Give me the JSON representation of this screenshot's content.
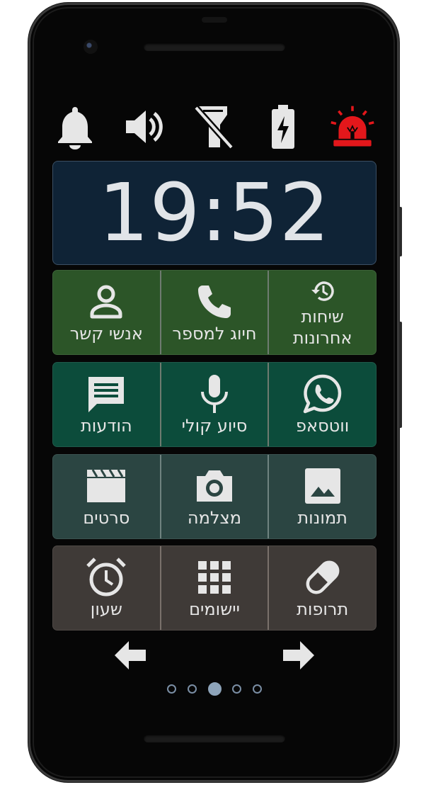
{
  "clock": {
    "time": "19:52"
  },
  "status_icons": [
    "bell-icon",
    "volume-icon",
    "flashlight-off-icon",
    "battery-charging-icon",
    "emergency-siren-icon"
  ],
  "colors": {
    "clock_bg": "#0f2336",
    "row1": "#2c5528",
    "row2": "#0c4c3b",
    "row3": "#2b4542",
    "row4": "#3f3a37",
    "siren": "#e3171b",
    "icon": "#e6e6e6"
  },
  "rows": [
    {
      "tiles": [
        {
          "label": "אנשי קשר",
          "icon": "person-icon"
        },
        {
          "label": "חיוג למספר",
          "icon": "phone-icon"
        },
        {
          "label_line1": "שיחות",
          "label_line2": "אחרונות",
          "icon": "history-icon"
        }
      ]
    },
    {
      "tiles": [
        {
          "label": "הודעות",
          "icon": "message-icon"
        },
        {
          "label": "סיוע קולי",
          "icon": "microphone-icon"
        },
        {
          "label": "ווטסאפ",
          "icon": "whatsapp-icon"
        }
      ]
    },
    {
      "tiles": [
        {
          "label": "סרטים",
          "icon": "clapperboard-icon"
        },
        {
          "label": "מצלמה",
          "icon": "camera-icon"
        },
        {
          "label": "תמונות",
          "icon": "image-icon"
        }
      ]
    },
    {
      "tiles": [
        {
          "label": "שעון",
          "icon": "alarm-clock-icon"
        },
        {
          "label": "יישומים",
          "icon": "apps-grid-icon"
        },
        {
          "label": "תרופות",
          "icon": "pill-icon"
        }
      ]
    }
  ],
  "navigation": {
    "prev": "arrow-left-icon",
    "next": "arrow-right-icon"
  },
  "pager": {
    "pages": 5,
    "current": 3
  }
}
